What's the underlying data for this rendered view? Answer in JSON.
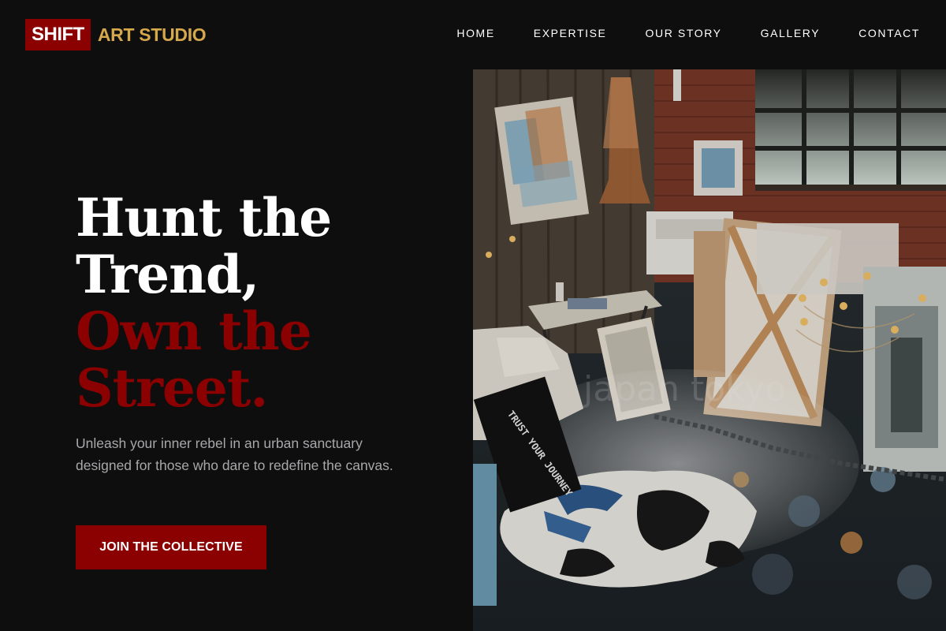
{
  "brand": {
    "mark": "SHIFT",
    "name": "ART STUDIO",
    "mark_bg": "#8b0000",
    "name_color": "#d4a84b"
  },
  "nav": {
    "items": [
      {
        "label": "HOME"
      },
      {
        "label": "EXPERTISE"
      },
      {
        "label": "OUR STORY"
      },
      {
        "label": "GALLERY"
      },
      {
        "label": "CONTACT"
      }
    ]
  },
  "hero": {
    "headline_line1": "Hunt the",
    "headline_line2": "Trend,",
    "headline_line3": "Own the",
    "headline_line4": "Street.",
    "subtitle": "Unleash your inner rebel in an urban sanctuary designed for those who dare to redefine the canvas.",
    "cta_label": "JOIN THE COLLECTIVE",
    "accent": "#8b0000"
  },
  "photo": {
    "canvas_text": "TRUST YOUR JOURNEY",
    "watermark": "japan tokyo"
  },
  "colors": {
    "background": "#0e0e0f",
    "text": "#ffffff",
    "muted": "#a8a8aa"
  }
}
